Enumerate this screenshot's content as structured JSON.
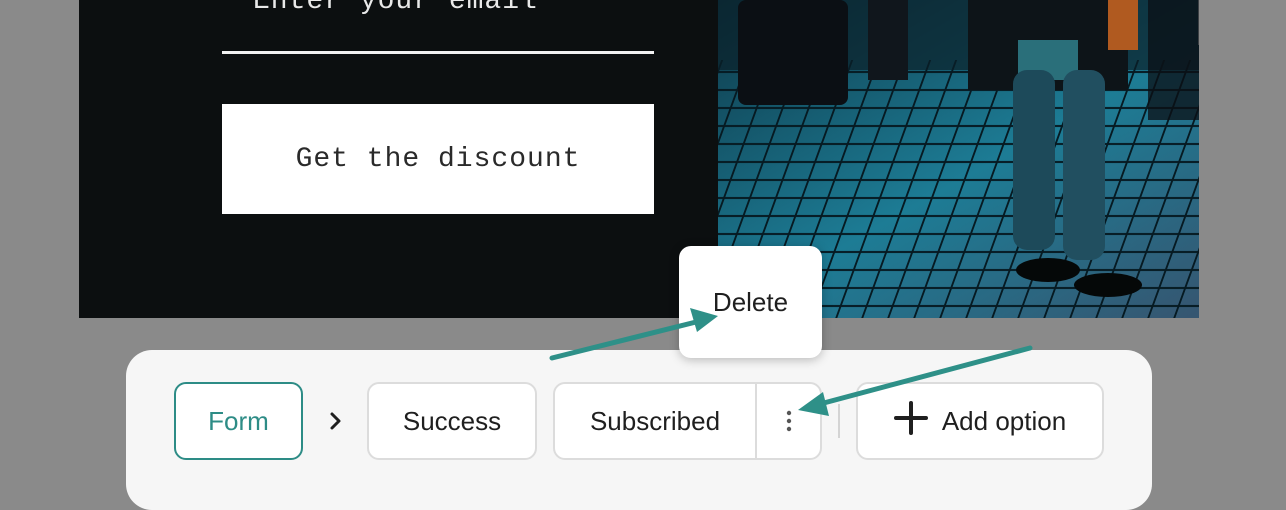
{
  "popup": {
    "email_placeholder": "Enter your email",
    "cta_label": "Get the discount"
  },
  "steps": {
    "form_label": "Form",
    "success_label": "Success",
    "subscribed_label": "Subscribed",
    "add_option_label": "Add option"
  },
  "menu": {
    "delete_label": "Delete"
  },
  "colors": {
    "accent": "#2d8c86",
    "annotation": "#2e9088"
  },
  "icons": {
    "chevron": "chevron-right-icon",
    "kebab": "more-vertical-icon",
    "plus": "plus-icon"
  }
}
